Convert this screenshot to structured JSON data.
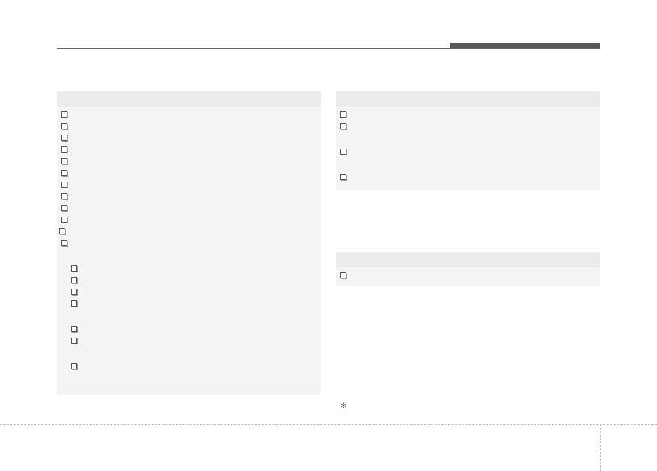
{
  "header": {
    "title": ""
  },
  "left_panel": {
    "title": "",
    "groups": [
      {
        "items": [
          "",
          "",
          "",
          "",
          "",
          "",
          "",
          "",
          "",
          "",
          "",
          ""
        ]
      },
      {
        "items": [
          "",
          "",
          "",
          ""
        ]
      },
      {
        "items": [
          "",
          ""
        ]
      },
      {
        "items": [
          ""
        ]
      }
    ]
  },
  "right_panel_top": {
    "title": "",
    "items": [
      "",
      "",
      "",
      ""
    ],
    "spaced_after_index": [
      1,
      2
    ]
  },
  "right_panel_bottom": {
    "title": "",
    "items": [
      ""
    ]
  },
  "marks": {
    "cross": "✻"
  }
}
